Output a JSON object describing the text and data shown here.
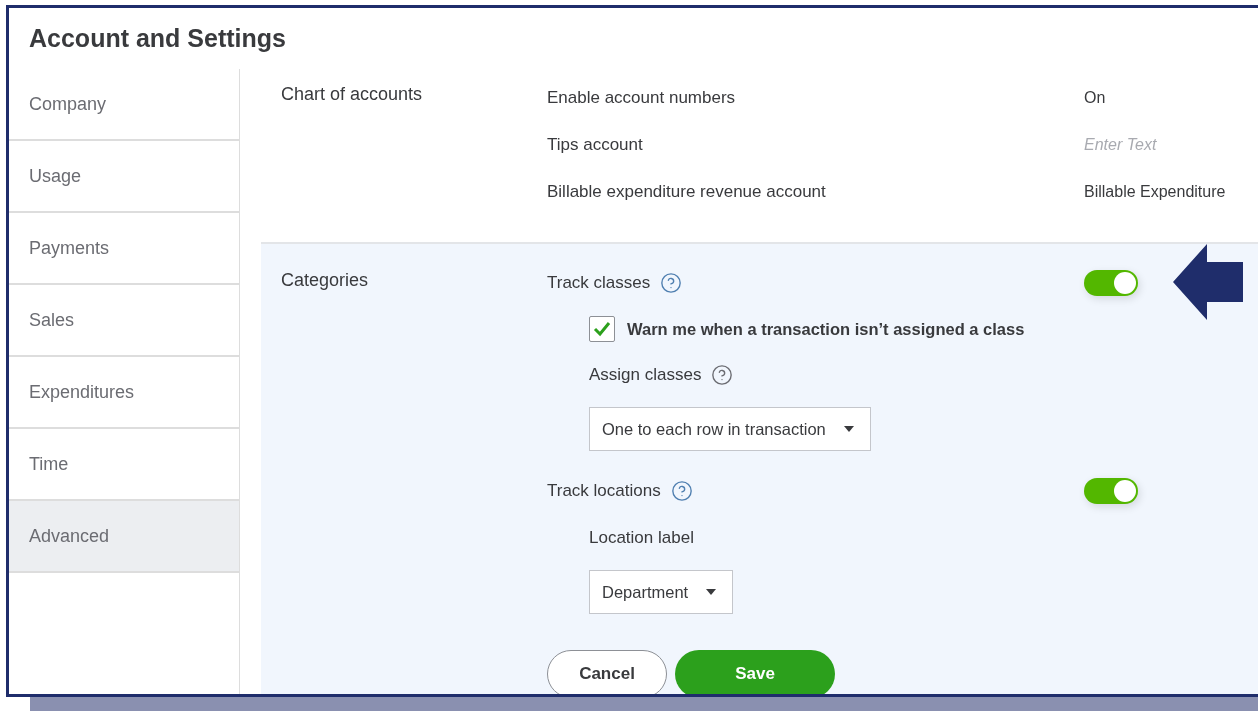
{
  "window": {
    "title": "Account and Settings"
  },
  "sidebar": {
    "items": [
      {
        "label": "Company",
        "selected": false
      },
      {
        "label": "Usage",
        "selected": false
      },
      {
        "label": "Payments",
        "selected": false
      },
      {
        "label": "Sales",
        "selected": false
      },
      {
        "label": "Expenditures",
        "selected": false
      },
      {
        "label": "Time",
        "selected": false
      },
      {
        "label": "Advanced",
        "selected": true
      }
    ]
  },
  "sections": [
    {
      "label": "Chart of accounts",
      "highlighted": false,
      "rows": [
        {
          "kind": "value",
          "label": "Enable account numbers",
          "value": "On"
        },
        {
          "kind": "input",
          "label": "Tips account",
          "placeholder": "Enter Text"
        },
        {
          "kind": "value",
          "label": "Billable expenditure revenue account",
          "value": "Billable Expenditure"
        }
      ]
    },
    {
      "label": "Categories",
      "highlighted": true,
      "annotations": [
        {
          "kind": "arrow"
        }
      ],
      "rows": [
        {
          "kind": "toggle",
          "label": "Track classes",
          "help": true,
          "on": true
        },
        {
          "kind": "checkbox",
          "label": "Warn me when a transaction isn’t assigned a class",
          "checked": true
        },
        {
          "kind": "sublabel",
          "label": "Assign classes",
          "help": true
        },
        {
          "kind": "dropdown",
          "value": "One to each row in transaction"
        },
        {
          "kind": "toggle",
          "label": "Track locations",
          "help": true,
          "on": true
        },
        {
          "kind": "sublabel",
          "label": "Location label",
          "help": false
        },
        {
          "kind": "dropdown",
          "value": "Department"
        }
      ],
      "buttons": [
        {
          "label": "Cancel",
          "kind": "secondary"
        },
        {
          "label": "Save",
          "kind": "primary"
        }
      ]
    }
  ]
}
